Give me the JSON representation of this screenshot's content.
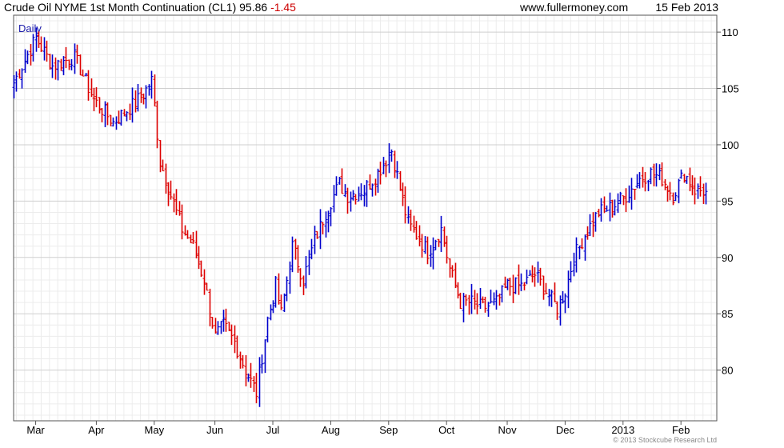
{
  "header": {
    "title": "Crude Oil NYME 1st Month Continuation (CL1) 95.86",
    "change": "-1.45",
    "site": "www.fullermoney.com",
    "date": "15 Feb 2013"
  },
  "period_label": "Daily",
  "footer": "© 2013 Stockcube Research Ltd",
  "colors": {
    "up": "#0000cc",
    "down": "#dd0000",
    "grid": "#d8d8d8",
    "period": "#1a1aaa"
  },
  "chart_data": {
    "type": "ohlc-bar",
    "title": "Crude Oil NYME 1st Month Continuation (CL1)",
    "ylim": [
      75.5,
      111.5
    ],
    "y_ticks": [
      80,
      85,
      90,
      95,
      100,
      105,
      110
    ],
    "y_axis_side": "right",
    "x_labels": [
      "Mar",
      "Apr",
      "May",
      "Jun",
      "Jul",
      "Aug",
      "Sep",
      "Oct",
      "Nov",
      "Dec",
      "2013",
      "Feb"
    ],
    "x_label_days": [
      8,
      30,
      51,
      73,
      94,
      115,
      136,
      157,
      179,
      200,
      221,
      242
    ],
    "grid": true,
    "series": [
      {
        "days": [
          0,
          8,
          14,
          22,
          29,
          36,
          43,
          47,
          50,
          51,
          53,
          57,
          61,
          65,
          69,
          73,
          76,
          80,
          84,
          88,
          92,
          95,
          97,
          101,
          105,
          109,
          113,
          118,
          121,
          127,
          132,
          137,
          141,
          143,
          146,
          150,
          155,
          158,
          162,
          166,
          170,
          175,
          179,
          184,
          189,
          193,
          197,
          200,
          203,
          207,
          212,
          217,
          222,
          227,
          231,
          235,
          239,
          243,
          247,
          251
        ],
        "close": [
          105.5,
          109.5,
          107.0,
          107.8,
          104.0,
          102.0,
          103.5,
          104.5,
          105.7,
          103.5,
          98.5,
          95.5,
          92.5,
          91.0,
          88.0,
          83.0,
          84.0,
          82.5,
          80.0,
          78.0,
          84.5,
          87.5,
          85.0,
          91.0,
          88.0,
          91.5,
          94.0,
          96.5,
          95.5,
          96.0,
          97.5,
          99.5,
          95.0,
          93.0,
          92.0,
          90.5,
          92.5,
          89.0,
          86.0,
          86.0,
          85.5,
          86.0,
          87.5,
          87.5,
          88.5,
          87.0,
          85.5,
          87.0,
          90.0,
          92.0,
          94.0,
          94.5,
          95.5,
          97.0,
          97.5,
          97.0,
          95.5,
          97.5,
          96.0,
          95.86
        ]
      }
    ]
  }
}
